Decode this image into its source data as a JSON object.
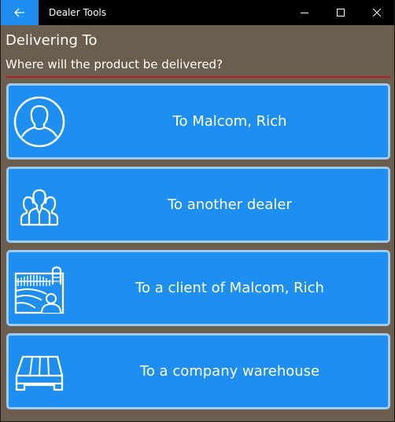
{
  "window": {
    "title": "Dealer Tools",
    "back_icon": "arrow-left-icon",
    "controls": [
      "minimize-icon",
      "maximize-icon",
      "close-icon"
    ]
  },
  "page": {
    "heading": "Delivering To",
    "subheading": "Where will the product be delivered?"
  },
  "options": [
    {
      "label": "To Malcom, Rich",
      "icon": "person-icon"
    },
    {
      "label": "To another dealer",
      "icon": "group-icon"
    },
    {
      "label": "To a client of Malcom, Rich",
      "icon": "farm-client-icon"
    },
    {
      "label": "To a company warehouse",
      "icon": "pallet-icon"
    }
  ],
  "colors": {
    "accent": "#1e8ef0",
    "card_border": "#9ecbf6",
    "background": "#6b5e4e",
    "divider": "#b51f1f",
    "titlebar": "#000000"
  }
}
